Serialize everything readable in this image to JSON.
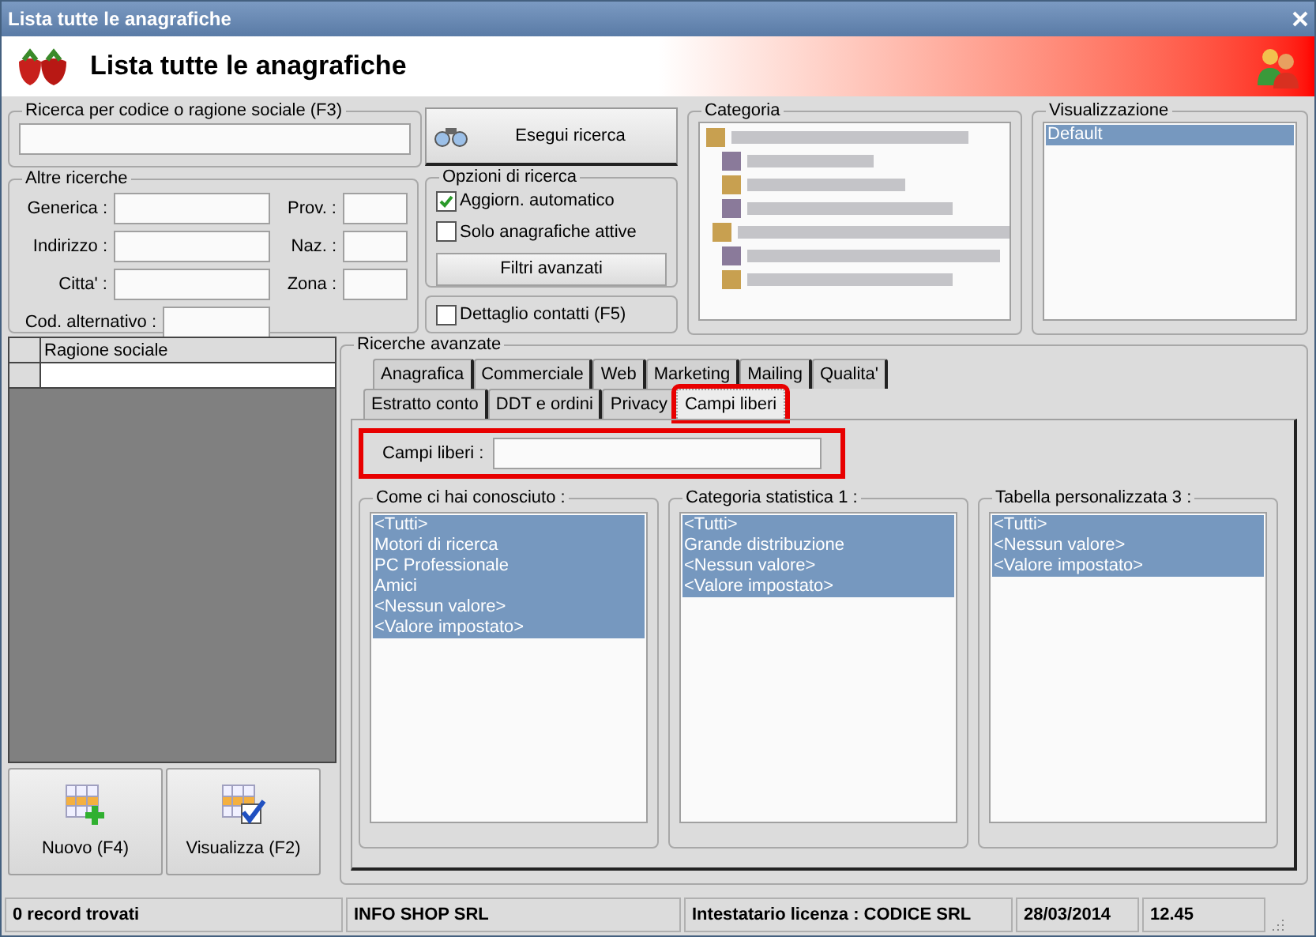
{
  "window": {
    "title": "Lista tutte le anagrafiche"
  },
  "header": {
    "title": "Lista tutte le anagrafiche"
  },
  "quick_search": {
    "legend": "Ricerca per codice o ragione sociale (F3)"
  },
  "search_button": {
    "label": "Esegui ricerca"
  },
  "other_searches": {
    "legend": "Altre ricerche",
    "left_fields": [
      {
        "label": "Generica :"
      },
      {
        "label": "Indirizzo :"
      },
      {
        "label": "Citta' :"
      }
    ],
    "right_fields": [
      {
        "label": "Prov. :"
      },
      {
        "label": "Naz. :"
      },
      {
        "label": "Zona :"
      }
    ],
    "alt_code": {
      "label": "Cod. alternativo :"
    }
  },
  "search_options": {
    "legend": "Opzioni di ricerca",
    "options": [
      {
        "label": "Aggiorn. automatico",
        "checked": true
      },
      {
        "label": "Solo anagrafiche attive",
        "checked": false
      }
    ],
    "button": "Filtri avanzati"
  },
  "contact_detail": {
    "label": "Dettaglio contatti (F5)",
    "checked": false
  },
  "category": {
    "legend": "Categoria"
  },
  "view": {
    "legend": "Visualizzazione",
    "items": [
      {
        "label": "Default",
        "selected": true
      }
    ]
  },
  "grid": {
    "columns": [
      "Ragione sociale"
    ]
  },
  "actions": [
    {
      "label": "Nuovo (F4)",
      "kind": "new"
    },
    {
      "label": "Visualizza (F2)",
      "kind": "view"
    }
  ],
  "advanced": {
    "legend": "Ricerche avanzate",
    "back_tabs": [
      {
        "label": "Anagrafica",
        "selected": false
      },
      {
        "label": "Commerciale",
        "selected": false
      },
      {
        "label": "Web",
        "selected": false
      },
      {
        "label": "Marketing",
        "selected": false
      },
      {
        "label": "Mailing",
        "selected": false
      },
      {
        "label": "Qualita'",
        "selected": false
      }
    ],
    "front_tabs": [
      {
        "label": "Estratto conto",
        "selected": false
      },
      {
        "label": "DDT e ordini",
        "selected": false
      },
      {
        "label": "Privacy",
        "selected": false
      },
      {
        "label": "Campi liberi",
        "selected": true
      }
    ],
    "free_fields": {
      "label": "Campi liberi :"
    },
    "lists": [
      {
        "title": "Come ci hai conosciuto :",
        "items": [
          {
            "label": "<Tutti>",
            "selected": true
          },
          {
            "label": "Motori di ricerca",
            "selected": true
          },
          {
            "label": "PC Professionale",
            "selected": true
          },
          {
            "label": "Amici",
            "selected": true
          },
          {
            "label": "<Nessun valore>",
            "selected": true
          },
          {
            "label": "<Valore impostato>",
            "selected": true
          }
        ]
      },
      {
        "title": "Categoria statistica 1 :",
        "items": [
          {
            "label": "<Tutti>",
            "selected": true
          },
          {
            "label": "Grande distribuzione",
            "selected": true
          },
          {
            "label": "<Nessun valore>",
            "selected": true
          },
          {
            "label": "<Valore impostato>",
            "selected": true
          }
        ]
      },
      {
        "title": "Tabella personalizzata 3 :",
        "items": [
          {
            "label": "<Tutti>",
            "selected": true
          },
          {
            "label": "<Nessun valore>",
            "selected": true
          },
          {
            "label": "<Valore impostato>",
            "selected": true
          }
        ]
      }
    ]
  },
  "status_bar": [
    "0 record trovati",
    "INFO SHOP SRL",
    "Intestatario licenza : CODICE SRL",
    "28/03/2014",
    "12.45"
  ]
}
